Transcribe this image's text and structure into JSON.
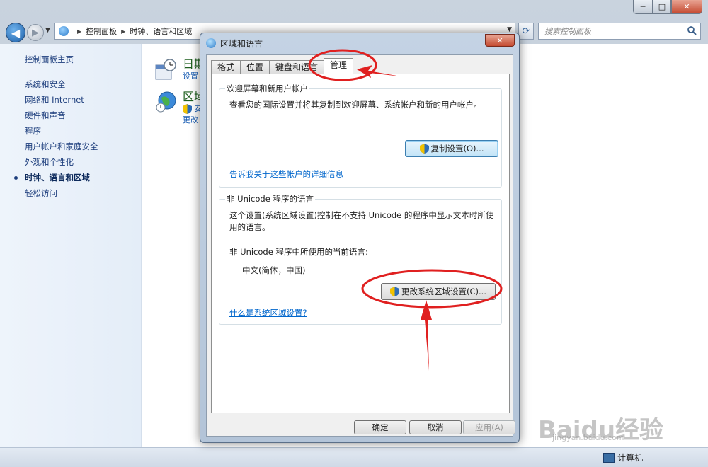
{
  "explorer": {
    "window_controls": {
      "min": "─",
      "max": "□",
      "close": "✕"
    },
    "breadcrumb": [
      "控制面板",
      "时钟、语言和区域"
    ],
    "search": {
      "placeholder": "搜索控制面板"
    },
    "sidebar": {
      "home": "控制面板主页",
      "items": [
        {
          "label": "系统和安全",
          "active": false
        },
        {
          "label": "网络和 Internet",
          "active": false
        },
        {
          "label": "硬件和声音",
          "active": false
        },
        {
          "label": "程序",
          "active": false
        },
        {
          "label": "用户帐户和家庭安全",
          "active": false
        },
        {
          "label": "外观和个性化",
          "active": false
        },
        {
          "label": "时钟、语言和区域",
          "active": true
        },
        {
          "label": "轻松访问",
          "active": false
        }
      ]
    },
    "categories": [
      {
        "title": "日期",
        "sub1": "设置",
        "sub2": ""
      },
      {
        "title": "区域",
        "sub1": "安",
        "sub2": "更改"
      }
    ],
    "statusbar": {
      "computer": "计算机"
    }
  },
  "dialog": {
    "title": "区域和语言",
    "close": "✕",
    "tabs": [
      {
        "label": "格式",
        "active": false
      },
      {
        "label": "位置",
        "active": false
      },
      {
        "label": "键盘和语言",
        "active": false
      },
      {
        "label": "管理",
        "active": true
      }
    ],
    "welcome_group": {
      "title": "欢迎屏幕和新用户帐户",
      "description": "查看您的国际设置并将其复制到欢迎屏幕、系统帐户和新的用户帐户。",
      "copy_button": "复制设置(O)...",
      "link": "告诉我关于这些帐户的详细信息"
    },
    "unicode_group": {
      "title": "非 Unicode 程序的语言",
      "description_line1": "这个设置(系统区域设置)控制在不支持 Unicode 的程序中显示文本时所使",
      "description_line2": "用的语言。",
      "current_label": "非 Unicode 程序中所使用的当前语言:",
      "current_value": "中文(简体，中国)",
      "change_button": "更改系统区域设置(C)...",
      "link": "什么是系统区域设置?"
    },
    "footer": {
      "ok": "确定",
      "cancel": "取消",
      "apply": "应用(A)"
    }
  },
  "watermark": {
    "brand": "Baidu经验",
    "url": "jingyan.baidu.com"
  },
  "colors": {
    "annotation": "#e02020",
    "link": "#0066cc",
    "sidebar_text": "#1c3d7c"
  }
}
